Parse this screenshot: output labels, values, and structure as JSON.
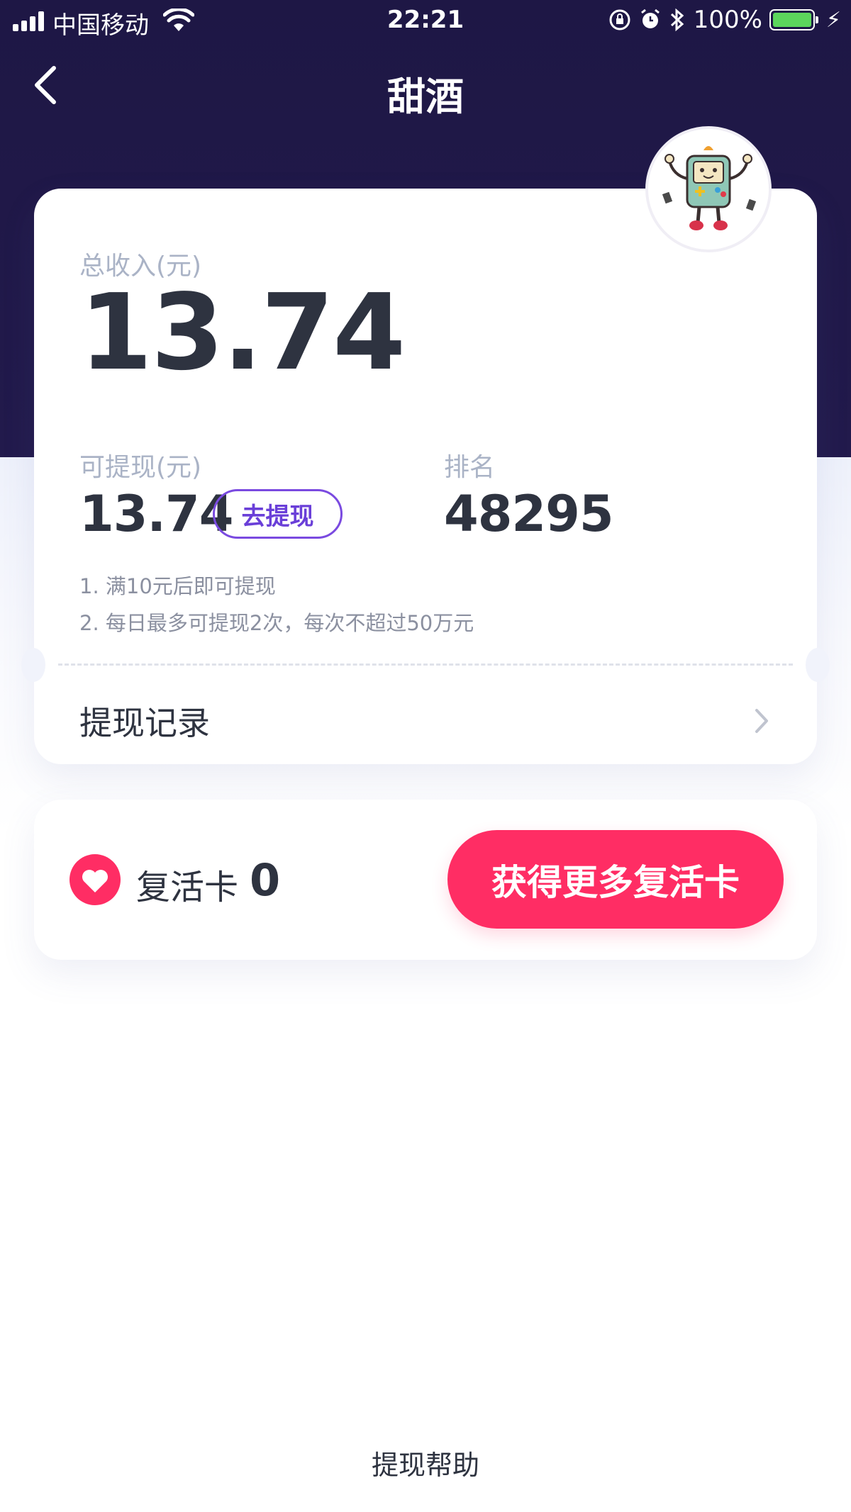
{
  "status_bar": {
    "carrier": "中国移动",
    "time": "22:21",
    "battery_percent": "100%",
    "battery_level": 1.0,
    "icons": [
      "signal-icon",
      "wifi-icon",
      "orientation-lock-icon",
      "alarm-icon",
      "bluetooth-icon",
      "battery-icon",
      "charging-icon"
    ]
  },
  "nav": {
    "title": "甜酒",
    "back_icon": "chevron-left-icon"
  },
  "earnings": {
    "total_label": "总收入(元)",
    "total_amount": "13.74",
    "withdrawable_label": "可提现(元)",
    "withdrawable_amount": "13.74",
    "withdraw_button": "去提现",
    "rank_label": "排名",
    "rank_value": "48295",
    "rules": [
      "1.  满10元后即可提现",
      "2.  每日最多可提现2次，每次不超过50万元"
    ],
    "records_label": "提现记录"
  },
  "revive": {
    "label": "复活卡",
    "count": "0",
    "button": "获得更多复活卡"
  },
  "footer": {
    "help_link": "提现帮助"
  },
  "colors": {
    "header_bg": "#1e1745",
    "accent_purple": "#6a3fd8",
    "accent_pink": "#ff2d64",
    "battery_green": "#5cd65c"
  }
}
